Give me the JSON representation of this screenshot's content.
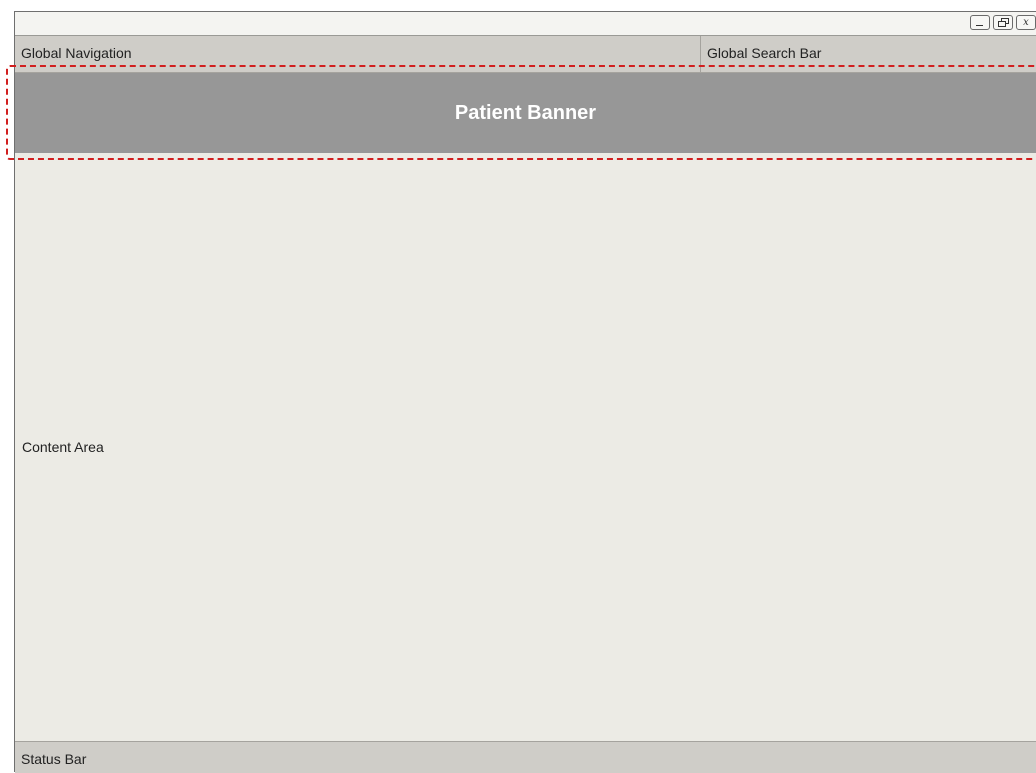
{
  "window": {
    "controls": {
      "minimize_label": "_",
      "close_label": "x"
    }
  },
  "header": {
    "global_navigation": "Global Navigation",
    "global_search_bar": "Global Search Bar"
  },
  "patient_banner": {
    "title": "Patient Banner",
    "highlight_color": "#d11e1e"
  },
  "content": {
    "label": "Content Area"
  },
  "status_bar": {
    "label": "Status Bar"
  },
  "colors": {
    "banner_bg": "#979797",
    "nav_bg": "#cfcdc8",
    "content_bg": "#ecebe5"
  }
}
